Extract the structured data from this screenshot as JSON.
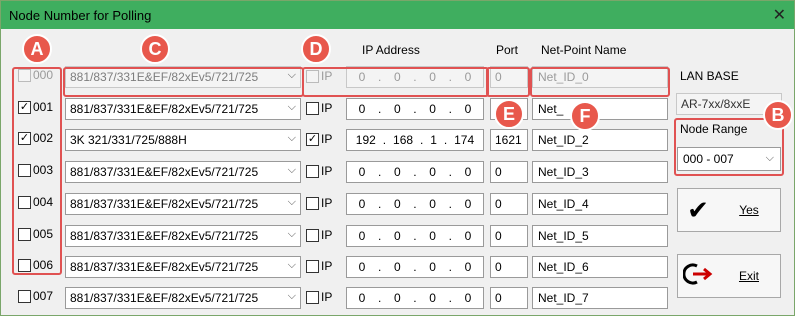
{
  "window": {
    "title": "Node Number for Polling",
    "close_glyph": "✕"
  },
  "headers": {
    "ip_address": "IP Address",
    "port": "Port",
    "net_point_name": "Net-Point Name"
  },
  "rows": [
    {
      "label": "000",
      "checked": false,
      "disabled": true,
      "module": "881/837/331E&EF/82xEv5/721/725",
      "ip_checked": false,
      "ip_label": "IP",
      "ip": [
        "0",
        "0",
        "0",
        "0"
      ],
      "port": "0",
      "name": "Net_ID_0"
    },
    {
      "label": "001",
      "checked": true,
      "disabled": false,
      "module": "881/837/331E&EF/82xEv5/721/725",
      "ip_checked": false,
      "ip_label": "IP",
      "ip": [
        "0",
        "0",
        "0",
        "0"
      ],
      "port": "",
      "name": "Net_"
    },
    {
      "label": "002",
      "checked": true,
      "disabled": false,
      "module": "3K 321/331/725/888H",
      "ip_checked": true,
      "ip_label": "IP",
      "ip": [
        "192",
        "168",
        "1",
        "174"
      ],
      "port": "1621",
      "name": "Net_ID_2"
    },
    {
      "label": "003",
      "checked": false,
      "disabled": false,
      "module": "881/837/331E&EF/82xEv5/721/725",
      "ip_checked": false,
      "ip_label": "IP",
      "ip": [
        "0",
        "0",
        "0",
        "0"
      ],
      "port": "0",
      "name": "Net_ID_3"
    },
    {
      "label": "004",
      "checked": false,
      "disabled": false,
      "module": "881/837/331E&EF/82xEv5/721/725",
      "ip_checked": false,
      "ip_label": "IP",
      "ip": [
        "0",
        "0",
        "0",
        "0"
      ],
      "port": "0",
      "name": "Net_ID_4"
    },
    {
      "label": "005",
      "checked": false,
      "disabled": false,
      "module": "881/837/331E&EF/82xEv5/721/725",
      "ip_checked": false,
      "ip_label": "IP",
      "ip": [
        "0",
        "0",
        "0",
        "0"
      ],
      "port": "0",
      "name": "Net_ID_5"
    },
    {
      "label": "006",
      "checked": false,
      "disabled": false,
      "module": "881/837/331E&EF/82xEv5/721/725",
      "ip_checked": false,
      "ip_label": "IP",
      "ip": [
        "0",
        "0",
        "0",
        "0"
      ],
      "port": "0",
      "name": "Net_ID_6"
    },
    {
      "label": "007",
      "checked": false,
      "disabled": false,
      "module": "881/837/331E&EF/82xEv5/721/725",
      "ip_checked": false,
      "ip_label": "IP",
      "ip": [
        "0",
        "0",
        "0",
        "0"
      ],
      "port": "0",
      "name": "Net_ID_7"
    }
  ],
  "side": {
    "lan_base_label": "LAN BASE",
    "lan_base_value": "AR-7xx/8xxE",
    "node_range_label": "Node Range",
    "node_range_value": "000 - 007",
    "yes_label": "Yes",
    "exit_label": "Exit"
  },
  "callouts": [
    "A",
    "B",
    "C",
    "D",
    "E",
    "F"
  ],
  "colors": {
    "titlebar": "#3fae5f",
    "callout": "#e8584c",
    "highlight_box": "#e05252"
  }
}
